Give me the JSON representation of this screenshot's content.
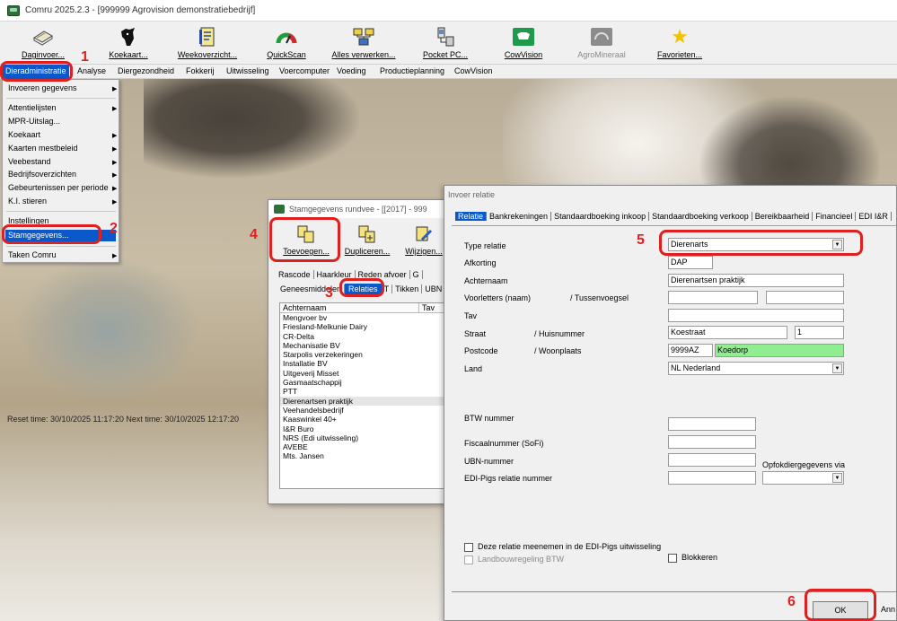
{
  "app": {
    "title": "Comru 2025.2.3  -  [999999 Agrovision demonstratiebedrijf]",
    "reset_time": "Reset time: 30/10/2025 11:17:20    Next time: 30/10/2025 12:17:20"
  },
  "toolbar": {
    "items": [
      {
        "label": "Daginvoer...",
        "icon": "notebook-icon"
      },
      {
        "label": "Koekaart...",
        "icon": "cow-head-icon"
      },
      {
        "label": "Weekoverzicht...",
        "icon": "document-icon"
      },
      {
        "label": "QuickScan",
        "icon": "gauge-icon"
      },
      {
        "label": "Alles verwerken...",
        "icon": "network-icon"
      },
      {
        "label": "Pocket PC...",
        "icon": "pocket-pc-icon"
      },
      {
        "label": "CowVision",
        "icon": "cowvision-icon"
      },
      {
        "label": "AgroMineraal",
        "icon": "agromineraal-icon"
      },
      {
        "label": "Favorieten...",
        "icon": "star-icon"
      }
    ]
  },
  "menubar": {
    "items": [
      "Dieradministratie",
      "Analyse",
      "Diergezondheid",
      "Fokkerij",
      "Uitwisseling",
      "Voercomputer",
      "Voeding",
      "Productieplanning",
      "CowVision"
    ]
  },
  "dropdown": {
    "items": [
      {
        "label": "Invoeren gegevens",
        "arrow": "▶"
      },
      {
        "label": "Attentielijsten",
        "arrow": "▶"
      },
      {
        "label": "MPR-Uitslag...",
        "arrow": ""
      },
      {
        "label": "Koekaart",
        "arrow": "▶"
      },
      {
        "label": "Kaarten mestbeleid",
        "arrow": "▶"
      },
      {
        "label": "Veebestand",
        "arrow": "▶"
      },
      {
        "label": "Bedrijfsoverzichten",
        "arrow": "▶"
      },
      {
        "label": "Gebeurtenissen per periode",
        "arrow": "▶"
      },
      {
        "label": "K.I. stieren",
        "arrow": "▶"
      },
      {
        "label": "Instellingen",
        "arrow": ""
      },
      {
        "label": "Stamgegevens...",
        "arrow": ""
      },
      {
        "label": "Taken Comru",
        "arrow": "▶"
      }
    ]
  },
  "annotations": [
    "1",
    "2",
    "3",
    "4",
    "5",
    "6"
  ],
  "stamgegevens": {
    "title": "Stamgegevens rundvee  -  [[2017] - 999",
    "buttons": [
      "Toevoegen...",
      "Dupliceren...",
      "Wijzigen..."
    ],
    "tabs_row1": [
      "Rascode",
      "Haarkleur",
      "Reden afvoer",
      "G"
    ],
    "tabs_row2": [
      "Geneesmiddelen",
      "Relaties",
      "T",
      "Tikken",
      "UBN"
    ],
    "columns": [
      "Achternaam",
      "Tav"
    ],
    "rows": [
      "Mengvoer bv",
      "Friesland-Melkunie Dairy",
      "CR-Delta",
      "Mechanisatie BV",
      "Starpolis verzekeringen",
      "Installatie BV",
      "Uitgeverij Misset",
      "Gasmaatschappij",
      "PTT",
      "Dierenartsen praktijk",
      "Veehandelsbedrijf",
      "Kaaswinkel 40+",
      "I&R Buro",
      "NRS (Edi uitwisseling)",
      "AVEBE",
      "Mts. Jansen"
    ]
  },
  "invoer": {
    "title": "Invoer relatie",
    "tabs": [
      "Relatie",
      "Bankrekeningen",
      "Standaardboeking inkoop",
      "Standaardboeking verkoop",
      "Bereikbaarheid",
      "Financieel",
      "EDI I&R"
    ],
    "labels": {
      "type_relatie": "Type relatie",
      "afkorting": "Afkorting",
      "achternaam": "Achternaam",
      "voorletters": "Voorletters (naam)",
      "tussenvoegsel": "/ Tussenvoegsel",
      "tav": "Tav",
      "straat": "Straat",
      "huisnummer": "/ Huisnummer",
      "postcode": "Postcode",
      "woonplaats": "/ Woonplaats",
      "land": "Land",
      "btw": "BTW nummer",
      "fiscaal": "Fiscaalnummer (SoFi)",
      "ubn": "UBN-nummer",
      "opfok": "Opfokdiergegevens via",
      "edi_pigs": "EDI-Pigs relatie nummer",
      "cb_edi": "Deze relatie meenemen in de EDI-Pigs uitwisseling",
      "cb_landbouw": "Landbouwregeling BTW",
      "cb_blokkeren": "Blokkeren"
    },
    "values": {
      "type_relatie": "Dierenarts",
      "afkorting": "DAP",
      "achternaam": "Dierenartsen praktijk",
      "straat": "Koestraat",
      "huisnummer": "1",
      "postcode": "9999AZ",
      "woonplaats": "Koedorp",
      "land": "NL  Nederland"
    },
    "ok_label": "OK",
    "cancel_partial": "Ann"
  }
}
